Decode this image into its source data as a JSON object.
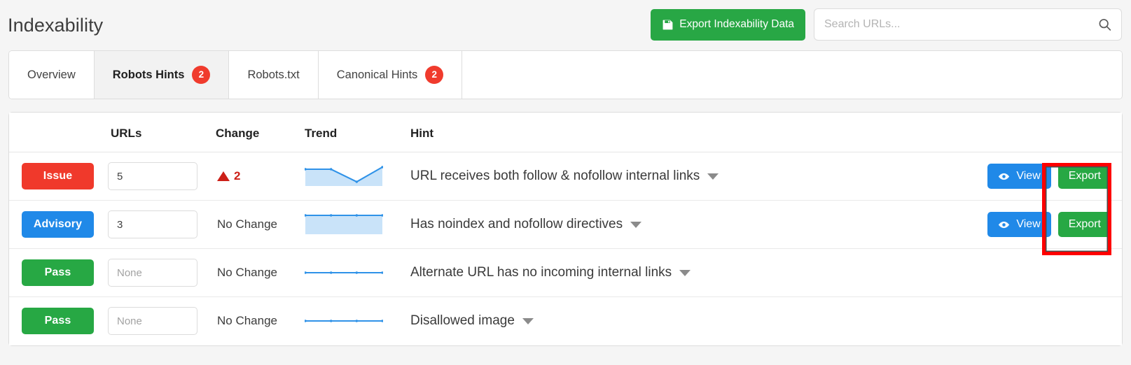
{
  "header": {
    "title": "Indexability",
    "export_button": {
      "label": "Export Indexability Data",
      "icon": "save-disk-icon",
      "color": "#28a745"
    },
    "search": {
      "placeholder": "Search URLs...",
      "value": "",
      "icon": "search-icon"
    }
  },
  "tabs": [
    {
      "label": "Overview",
      "badge": null,
      "active": false
    },
    {
      "label": "Robots Hints",
      "badge": "2",
      "active": true
    },
    {
      "label": "Robots.txt",
      "badge": null,
      "active": false
    },
    {
      "label": "Canonical Hints",
      "badge": "2",
      "active": false
    }
  ],
  "table": {
    "columns": [
      "",
      "URLs",
      "Change",
      "Trend",
      "Hint",
      ""
    ],
    "rows": [
      {
        "status": "Issue",
        "status_color": "#f0392b",
        "urls": "5",
        "urls_is_placeholder": false,
        "change": "2",
        "change_direction": "up",
        "change_color": "#cc2018",
        "trend_points": [
          8,
          8,
          2,
          9
        ],
        "trend_filled": true,
        "hint": "URL receives both follow & nofollow internal links",
        "view_label": "View",
        "export_label": "Export",
        "has_actions": true
      },
      {
        "status": "Advisory",
        "status_color": "#2089e8",
        "urls": "3",
        "urls_is_placeholder": false,
        "change": "No Change",
        "change_direction": "none",
        "change_color": "#3c3c3c",
        "trend_points": [
          9,
          9,
          9,
          9
        ],
        "trend_filled": true,
        "hint": "Has noindex and nofollow directives",
        "view_label": "View",
        "export_label": "Export",
        "has_actions": true
      },
      {
        "status": "Pass",
        "status_color": "#27a844",
        "urls": "None",
        "urls_is_placeholder": true,
        "change": "No Change",
        "change_direction": "none",
        "change_color": "#3c3c3c",
        "trend_points": [
          0,
          0,
          0,
          0
        ],
        "trend_filled": false,
        "hint": "Alternate URL has no incoming internal links",
        "view_label": "",
        "export_label": "",
        "has_actions": false
      },
      {
        "status": "Pass",
        "status_color": "#27a844",
        "urls": "None",
        "urls_is_placeholder": true,
        "change": "No Change",
        "change_direction": "none",
        "change_color": "#3c3c3c",
        "trend_points": [
          0,
          0,
          0,
          0
        ],
        "trend_filled": false,
        "hint": "Disallowed image",
        "view_label": "",
        "export_label": "",
        "has_actions": false
      }
    ]
  },
  "annotation": {
    "highlight_color": "#fe0000",
    "target": "export-buttons-column"
  }
}
